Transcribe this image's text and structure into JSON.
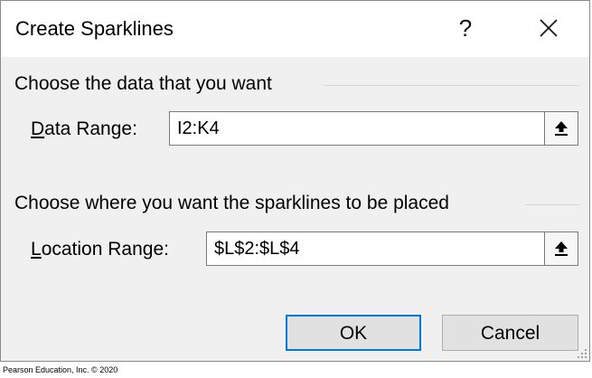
{
  "dialog": {
    "title": "Create Sparklines",
    "help_label": "?",
    "close_icon": "close-icon"
  },
  "data_section": {
    "heading": "Choose the data that you want",
    "field_label_accel": "D",
    "field_label_rest": "ata Range:",
    "value": "I2:K4",
    "collapse_icon": "collapse-dialog-icon"
  },
  "location_section": {
    "heading": "Choose where you want the sparklines to be placed",
    "field_label_accel": "L",
    "field_label_rest": "ocation Range:",
    "value": "$L$2:$L$4",
    "collapse_icon": "collapse-dialog-icon"
  },
  "buttons": {
    "ok": "OK",
    "cancel": "Cancel"
  },
  "credit": "Pearson Education, Inc. © 2020",
  "colors": {
    "dialog_bg": "#f0f0f0",
    "titlebar_bg": "#ffffff",
    "default_button_border": "#0078d7"
  }
}
